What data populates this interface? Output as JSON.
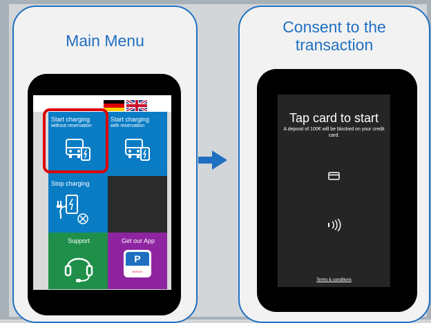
{
  "panels": {
    "left_title": "Main Menu",
    "right_title_line1": "Consent to the",
    "right_title_line2": "transaction"
  },
  "main_menu": {
    "tiles": [
      {
        "label": "Start charging",
        "sub": "without reservation"
      },
      {
        "label": "Start charging",
        "sub": "with reservation"
      },
      {
        "label": "Stop charging",
        "sub": ""
      },
      {
        "label": "",
        "sub": ""
      },
      {
        "label": "Support",
        "sub": ""
      },
      {
        "label": "Get our App",
        "sub": ""
      }
    ],
    "app_icon_text": "P",
    "brand_text": "BOSCH"
  },
  "payment": {
    "title": "Tap card to start",
    "subtitle": "A deposit of 100€ will be blocked on your credit card.",
    "terms": "Terms & conditions"
  },
  "colors": {
    "accent": "#1f6fc1",
    "tile_blue": "#0a7cc4",
    "tile_green": "#1f8f4a",
    "tile_purple": "#8f24a0",
    "highlight": "#dd0000"
  }
}
